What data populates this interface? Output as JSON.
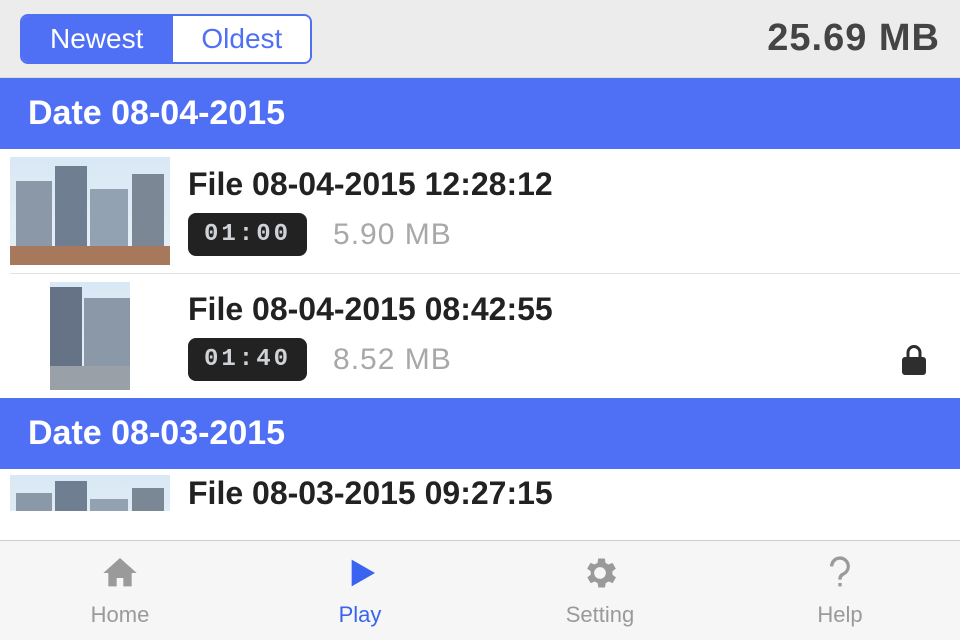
{
  "topbar": {
    "sort_newest": "Newest",
    "sort_oldest": "Oldest",
    "active_sort": "newest",
    "total_size": "25.69 MB"
  },
  "sections": [
    {
      "header": "Date 08-04-2015",
      "files": [
        {
          "title": "File 08-04-2015 12:28:12",
          "duration": "01:00",
          "size": "5.90 MB",
          "locked": false
        },
        {
          "title": "File 08-04-2015 08:42:55",
          "duration": "01:40",
          "size": "8.52 MB",
          "locked": true
        }
      ]
    },
    {
      "header": "Date 08-03-2015",
      "files": [
        {
          "title": "File 08-03-2015 09:27:15",
          "duration": "",
          "size": "",
          "locked": false
        }
      ]
    }
  ],
  "tabbar": {
    "home": "Home",
    "play": "Play",
    "setting": "Setting",
    "help": "Help",
    "active": "play"
  }
}
